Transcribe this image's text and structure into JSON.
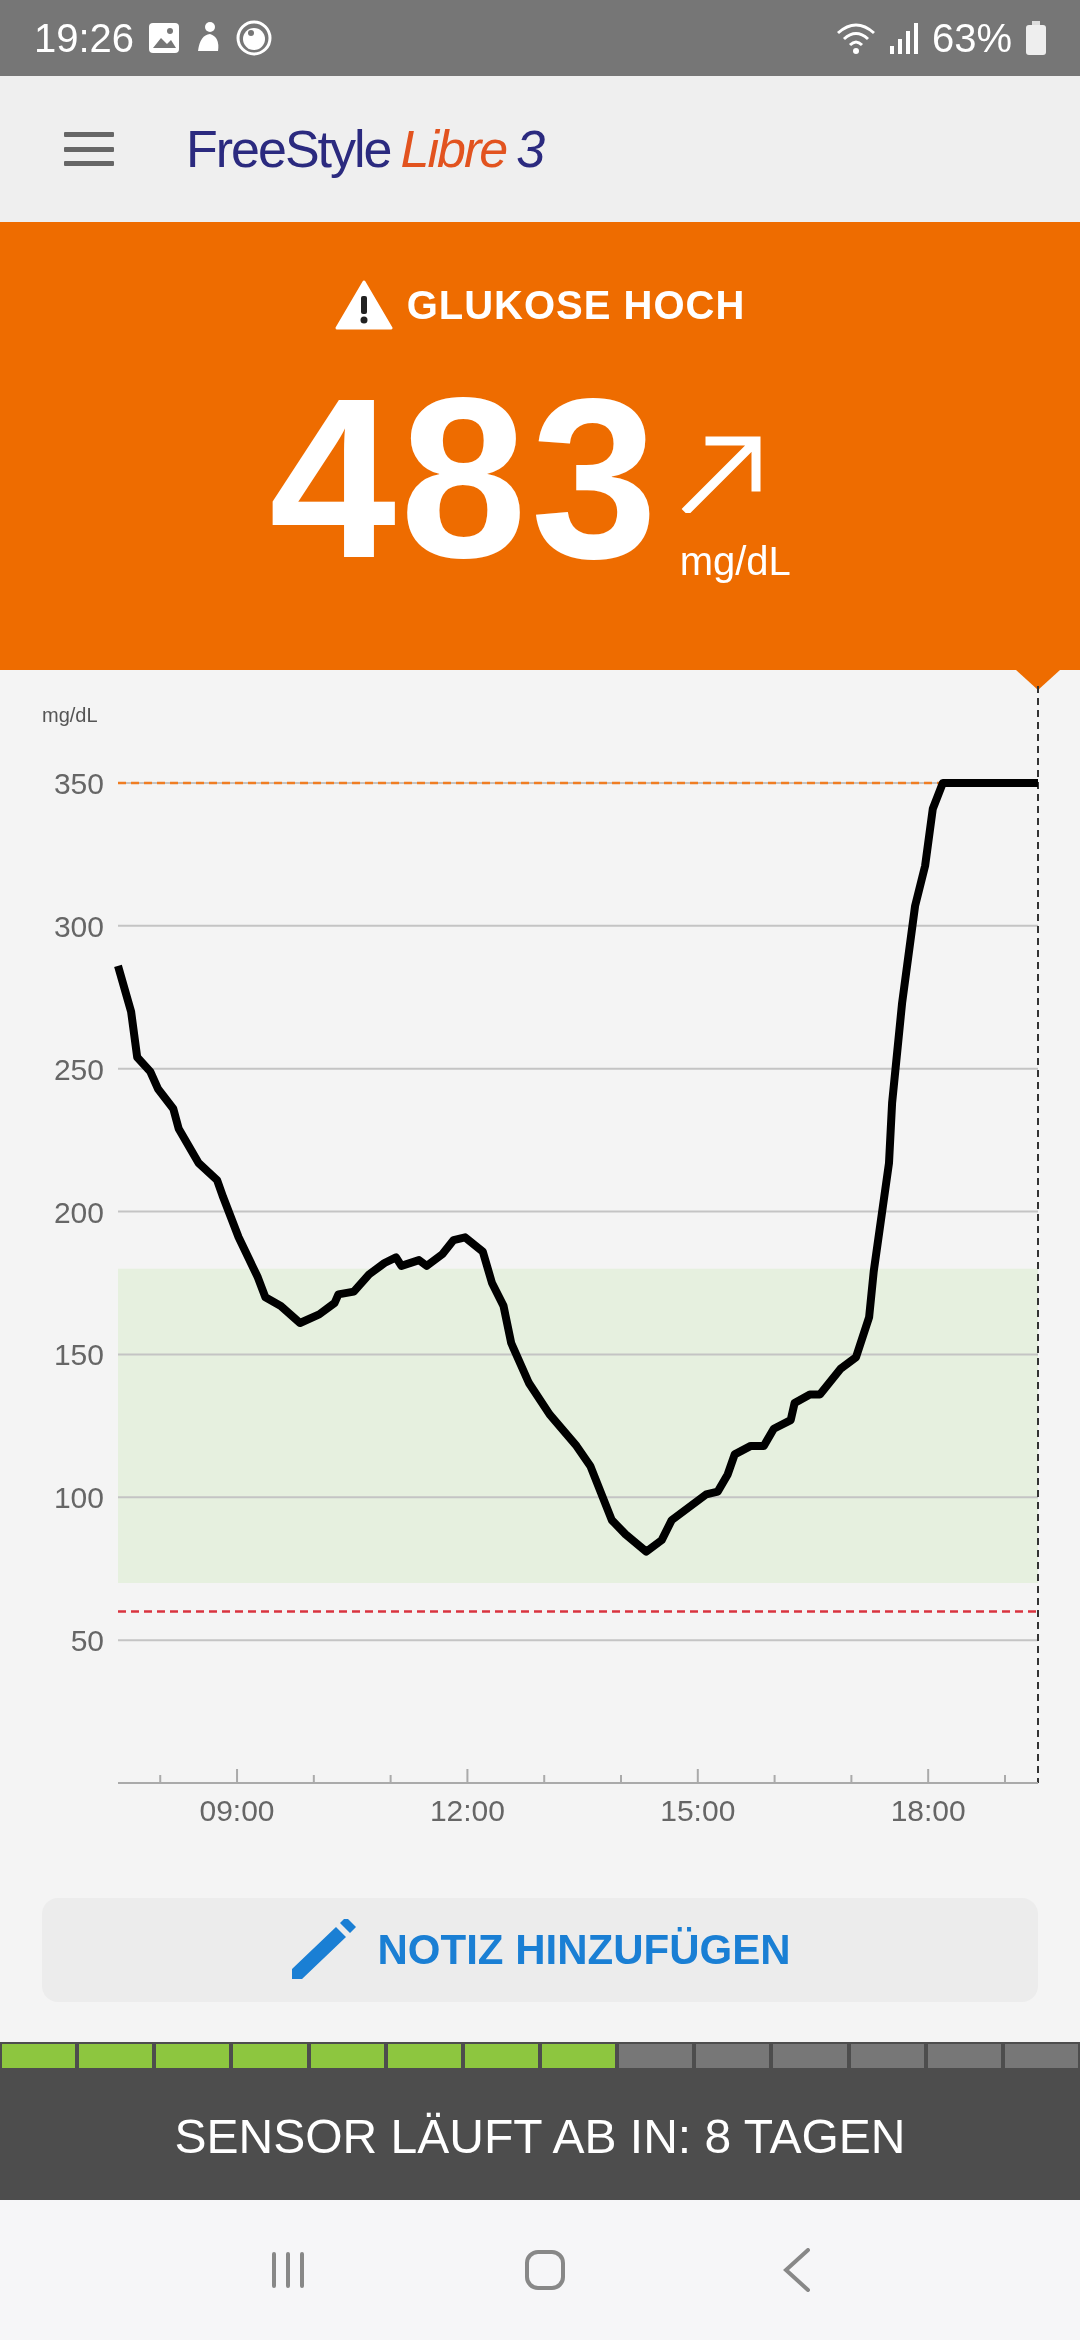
{
  "status_bar": {
    "time": "19:26",
    "battery": "63%"
  },
  "header": {
    "logo": {
      "brand": "FreeStyle",
      "product": "Libre",
      "version": "3"
    }
  },
  "alert": {
    "title": "GLUKOSE HOCH",
    "value": "483",
    "unit": "mg/dL"
  },
  "chart": {
    "chart_data": {
      "type": "line",
      "ylabel": "mg/dL",
      "xlim": [
        7.45,
        19.43
      ],
      "ylim": [
        0,
        350
      ],
      "xticks": [
        {
          "value": 9,
          "label": "09:00"
        },
        {
          "value": 12,
          "label": "12:00"
        },
        {
          "value": 15,
          "label": "15:00"
        },
        {
          "value": 18,
          "label": "18:00"
        }
      ],
      "yticks": [
        50,
        100,
        150,
        200,
        250,
        300,
        350
      ],
      "x": [
        7.45,
        7.62,
        7.7,
        7.87,
        7.97,
        8.17,
        8.24,
        8.5,
        8.74,
        8.82,
        9.02,
        9.27,
        9.37,
        9.57,
        9.82,
        10.07,
        10.27,
        10.32,
        10.52,
        10.72,
        10.92,
        11.07,
        11.14,
        11.37,
        11.47,
        11.67,
        11.82,
        11.97,
        12.2,
        12.32,
        12.47,
        12.57,
        12.8,
        13.07,
        13.42,
        13.6,
        13.88,
        14.06,
        14.33,
        14.53,
        14.66,
        15.11,
        15.26,
        15.39,
        15.48,
        15.69,
        15.86,
        15.99,
        16.21,
        16.26,
        16.46,
        16.59,
        16.86,
        17.06,
        17.23,
        17.29,
        17.49,
        17.53,
        17.66,
        17.83,
        17.96,
        18.06,
        18.19,
        19.43
      ],
      "grid": true,
      "series": [
        {
          "color": "#000000",
          "values": [
            286,
            270,
            254,
            249,
            243,
            236,
            229,
            217,
            211,
            205,
            191,
            177,
            170,
            167,
            161,
            164,
            168,
            171,
            172,
            178,
            182,
            184,
            181,
            183,
            181,
            185,
            190,
            191,
            186,
            175,
            167,
            154,
            140,
            129,
            118,
            111,
            92,
            87,
            81,
            85,
            92,
            101,
            102,
            108,
            115,
            118,
            118,
            124,
            127,
            133,
            136,
            136,
            145,
            149,
            163,
            179,
            217,
            238,
            273,
            307,
            321,
            341,
            350,
            350
          ]
        }
      ],
      "bands": [
        {
          "axis": "y",
          "from": 70,
          "to": 180,
          "color": "#e6f0df"
        }
      ],
      "ref_lines": [
        {
          "axis": "y",
          "value": 350,
          "color": "#ef7d22"
        },
        {
          "axis": "y",
          "value": 60,
          "color": "#d9333f"
        },
        {
          "axis": "x",
          "value": 19.43,
          "color": "#333333"
        }
      ]
    }
  },
  "note_button": {
    "label": "NOTIZ HINZUFÜGEN"
  },
  "sensor": {
    "segments": [
      {
        "filled": true
      },
      {
        "filled": true
      },
      {
        "filled": true
      },
      {
        "filled": true
      },
      {
        "filled": true
      },
      {
        "filled": true
      },
      {
        "filled": true
      },
      {
        "filled": true
      },
      {
        "filled": false
      },
      {
        "filled": false
      },
      {
        "filled": false
      },
      {
        "filled": false
      },
      {
        "filled": false
      },
      {
        "filled": false
      }
    ],
    "message": "SENSOR LÄUFT AB IN: 8 TAGEN"
  }
}
